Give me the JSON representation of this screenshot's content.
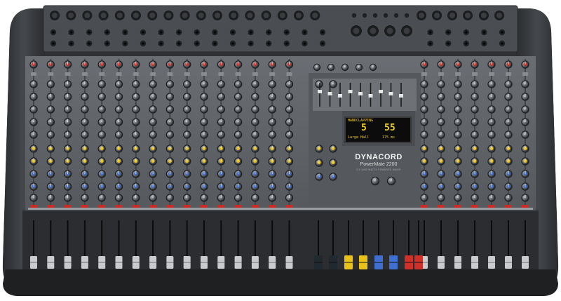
{
  "brand": "DYNACORD",
  "model": "PowerMate 2200",
  "subtitle": "2 X 1000 WATTS POWERED MIXER",
  "display": {
    "left_label": "HANDCLAPPING",
    "left_value": "5",
    "right_value": "55",
    "left_caption": "Large Hall",
    "right_caption": "175 ms"
  },
  "colors": {
    "body": "#3b3e42",
    "panel": "#5b5f64",
    "knob_yellow": "#e8c21a",
    "knob_blue": "#3f6fd0",
    "knob_red": "#d0302a",
    "display_text": "#f4d21a"
  },
  "channels": {
    "mono_count": 16,
    "stereo_count": 2,
    "graphic_eq_bands": 9
  },
  "master_faders": {
    "cap_colors": [
      "#202830",
      "#202830",
      "#e8c21a",
      "#e8c21a",
      "#3f6fd0",
      "#3f6fd0",
      "#d0302a",
      "#d0302a"
    ]
  }
}
